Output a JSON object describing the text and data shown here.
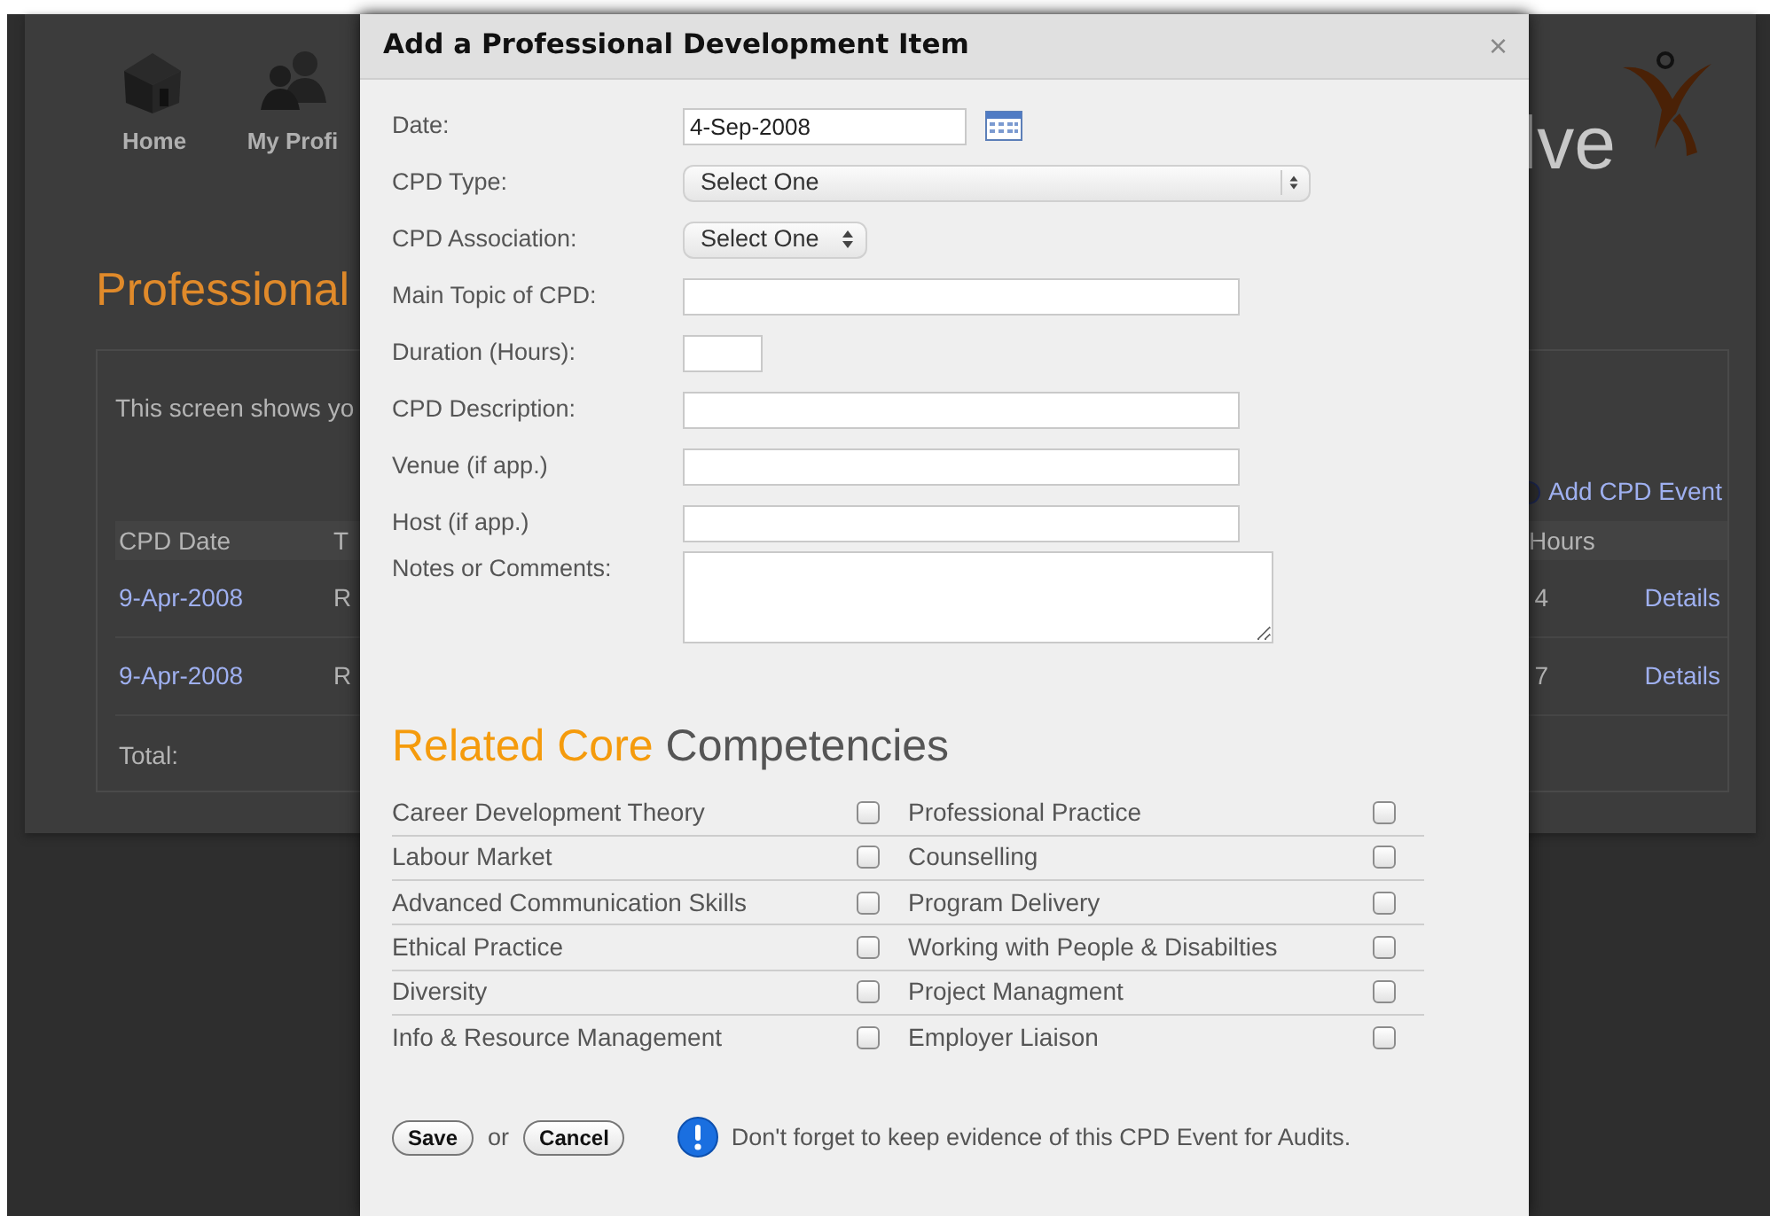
{
  "background_page": {
    "nav": [
      {
        "label": "Home",
        "kind": "house"
      },
      {
        "label": "My Profi",
        "kind": "people"
      }
    ],
    "logo_text": "lve",
    "heading": "Professional",
    "intro": "This screen shows yo",
    "add_link": "Add CPD Event",
    "table": {
      "columns": [
        "CPD Date",
        "T",
        "Hours"
      ],
      "rows": [
        {
          "cells": [
            "9-Apr-2008",
            "R",
            "4",
            "Details"
          ]
        },
        {
          "cells": [
            "9-Apr-2008",
            "R",
            "7",
            "Details"
          ]
        }
      ],
      "total": "Total:"
    }
  },
  "dialog": {
    "title": "Add a Professional Development Item",
    "close": "×",
    "fields": [
      {
        "label": "Date:",
        "kind": "date",
        "value": "4-Sep-2008"
      },
      {
        "label": "CPD Type:",
        "kind": "select-wide",
        "value": "Select One"
      },
      {
        "label": "CPD Association:",
        "kind": "select",
        "value": "Select One"
      },
      {
        "label": "Main Topic of CPD:",
        "kind": "text"
      },
      {
        "label": "Duration (Hours):",
        "kind": "short-text"
      },
      {
        "label": "CPD Description:",
        "kind": "text"
      },
      {
        "label": "Venue (if app.)",
        "kind": "text"
      },
      {
        "label": "Host (if app.)",
        "kind": "text"
      },
      {
        "label": "Notes or Comments:",
        "kind": "textarea"
      }
    ],
    "competencies_heading": {
      "accent": "Related Core",
      "rest": "Competencies"
    },
    "competencies": [
      {
        "label": "Career Development Theory",
        "checked": false
      },
      {
        "label": "Professional Practice",
        "checked": false
      },
      {
        "label": "Labour Market",
        "checked": false
      },
      {
        "label": "Counselling",
        "checked": false
      },
      {
        "label": "Advanced Communication Skills",
        "checked": false
      },
      {
        "label": "Program Delivery",
        "checked": false
      },
      {
        "label": "Ethical Practice",
        "checked": false
      },
      {
        "label": "Working with People & Disabilties",
        "checked": false
      },
      {
        "label": "Diversity",
        "checked": false
      },
      {
        "label": "Project Managment",
        "checked": false
      },
      {
        "label": "Info & Resource Management",
        "checked": false
      },
      {
        "label": "Employer Liaison",
        "checked": false
      }
    ],
    "buttons": {
      "save": "Save",
      "separator": "or",
      "cancel": "Cancel"
    },
    "notice": "Don't forget to keep evidence of this CPD Event for Audits."
  }
}
